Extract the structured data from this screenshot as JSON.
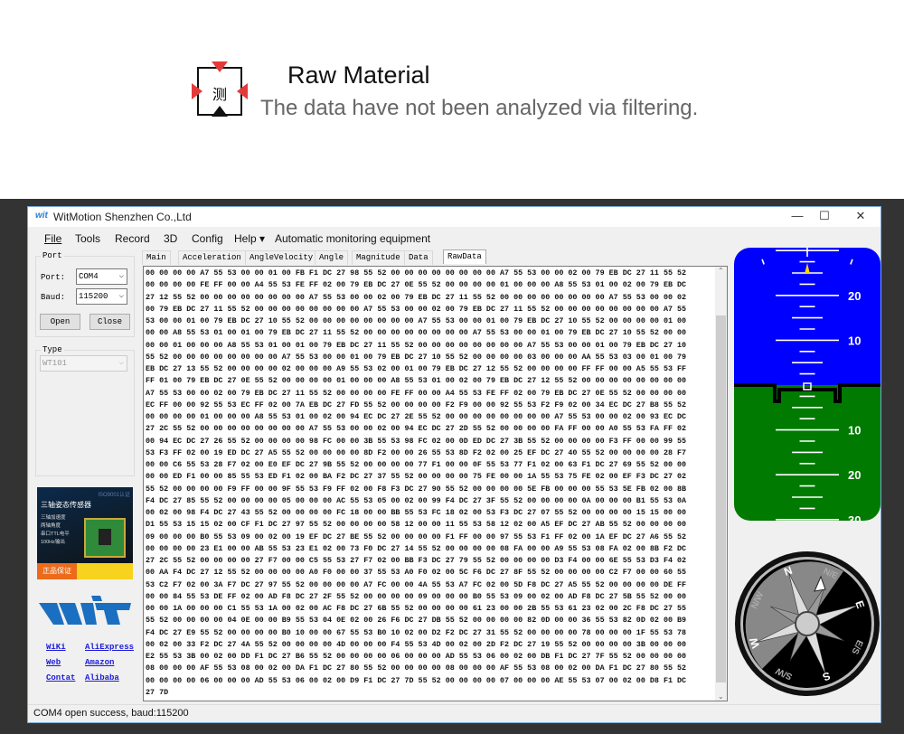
{
  "banner": {
    "icon_char": "测",
    "title": "Raw Material",
    "subtitle": "The data have not been analyzed via filtering."
  },
  "window": {
    "title": "WitMotion Shenzhen Co.,Ltd",
    "minimize": "—",
    "maximize": "☐",
    "close": "✕"
  },
  "menu": {
    "items": [
      {
        "label": "File"
      },
      {
        "label": "Tools"
      },
      {
        "label": "Record"
      },
      {
        "label": "3D"
      },
      {
        "label": "Config"
      },
      {
        "label": "Help ▾"
      }
    ],
    "caption": "Automatic monitoring equipment"
  },
  "port_group": {
    "legend": "Port",
    "port_label": "Port:",
    "port_value": "COM4",
    "baud_label": "Baud:",
    "baud_value": "115200",
    "open": "Open",
    "close": "Close"
  },
  "type_group": {
    "legend": "Type",
    "value": "WT101"
  },
  "ad": {
    "brand": "WIT",
    "cert": "ISO9001认证",
    "headline": "三轴姿态传感器",
    "features": [
      "三轴加速度",
      "两轴角度",
      "串口TTL电平",
      "100Hz输出"
    ],
    "badge": "正品保证"
  },
  "links": [
    {
      "label": "WiKi"
    },
    {
      "label": "AliExpress"
    },
    {
      "label": "Web"
    },
    {
      "label": "Amazon"
    },
    {
      "label": "Contat"
    },
    {
      "label": "Alibaba"
    }
  ],
  "tabs": [
    {
      "label": "Main"
    },
    {
      "label": "Acceleration"
    },
    {
      "label": "AngleVelocity"
    },
    {
      "label": "Angle"
    },
    {
      "label": "Magnitude"
    },
    {
      "label": "Data"
    },
    {
      "label": "RawData",
      "active": true
    }
  ],
  "raw_data": [
    "00 00 00 00 A7 55 53 00 00 01 00 FB F1 DC 27 98 55 52 00 00 00 00 00 00 00 00 A7 55 53 00 00 02 00 79 EB DC 27 11 55 52",
    "00 00 00 00 FE FF 00 00 A4 55 53 FE FF 02 00 79 EB DC 27 0E 55 52 00 00 00 00 01 00 00 00 A8 55 53 01 00 02 00 79 EB DC",
    "27 12 55 52 00 00 00 00 00 00 00 00 A7 55 53 00 00 02 00 79 EB DC 27 11 55 52 00 00 00 00 00 00 00 00 A7 55 53 00 00 02",
    "00 79 EB DC 27 11 55 52 00 00 00 00 00 00 00 00 A7 55 53 00 00 02 00 79 EB DC 27 11 55 52 00 00 00 00 00 00 00 00 A7 55",
    "53 00 00 01 00 79 EB DC 27 10 55 52 00 00 00 00 00 00 00 00 A7 55 53 00 00 01 00 79 EB DC 27 10 55 52 00 00 00 00 01 00",
    "00 00 A8 55 53 01 00 01 00 79 EB DC 27 11 55 52 00 00 00 00 00 00 00 00 A7 55 53 00 00 01 00 79 EB DC 27 10 55 52 00 00",
    "00 00 01 00 00 00 A8 55 53 01 00 01 00 79 EB DC 27 11 55 52 00 00 00 00 00 00 00 00 A7 55 53 00 00 01 00 79 EB DC 27 10",
    "55 52 00 00 00 00 00 00 00 00 A7 55 53 00 00 01 00 79 EB DC 27 10 55 52 00 00 00 00 03 00 00 00 AA 55 53 03 00 01 00 79",
    "EB DC 27 13 55 52 00 00 00 00 02 00 00 00 A9 55 53 02 00 01 00 79 EB DC 27 12 55 52 00 00 00 00 FF FF 00 00 A5 55 53 FF",
    "FF 01 00 79 EB DC 27 0E 55 52 00 00 00 00 01 00 00 00 A8 55 53 01 00 02 00 79 EB DC 27 12 55 52 00 00 00 00 00 00 00 00",
    "A7 55 53 00 00 02 00 79 EB DC 27 11 55 52 00 00 00 00 FE FF 00 00 A4 55 53 FE FF 02 00 79 EB DC 27 0E 55 52 00 00 00 00",
    "EC FF 00 00 92 55 53 EC FF 02 00 7A EB DC 27 FD 55 52 00 00 00 00 F2 F9 00 00 92 55 53 F2 F9 02 00 34 EC DC 27 B8 55 52",
    "00 00 00 00 01 00 00 00 A8 55 53 01 00 02 00 94 EC DC 27 2E 55 52 00 00 00 00 00 00 00 00 A7 55 53 00 00 02 00 93 EC DC",
    "27 2C 55 52 00 00 00 00 00 00 00 00 A7 55 53 00 00 02 00 94 EC DC 27 2D 55 52 00 00 00 00 FA FF 00 00 A0 55 53 FA FF 02",
    "00 94 EC DC 27 26 55 52 00 00 00 00 98 FC 00 00 3B 55 53 98 FC 02 00 0D ED DC 27 3B 55 52 00 00 00 00 F3 FF 00 00 99 55",
    "53 F3 FF 02 00 19 ED DC 27 A5 55 52 00 00 00 00 8D F2 00 00 26 55 53 8D F2 02 00 25 EF DC 27 40 55 52 00 00 00 00 28 F7",
    "00 00 C6 55 53 28 F7 02 00 E0 EF DC 27 9B 55 52 00 00 00 00 77 F1 00 00 0F 55 53 77 F1 02 00 63 F1 DC 27 69 55 52 00 00",
    "00 00 ED F1 00 00 85 55 53 ED F1 02 00 BA F2 DC 27 37 55 52 00 00 00 00 75 FE 00 00 1A 55 53 75 FE 02 00 EF F3 DC 27 02",
    "55 52 00 00 00 00 F9 FF 00 00 9F 55 53 F9 FF 02 00 F8 F3 DC 27 90 55 52 00 00 00 00 5E FB 00 00 00 55 53 5E FB 02 00 8B",
    "F4 DC 27 85 55 52 00 00 00 00 05 00 00 00 AC 55 53 05 00 02 00 99 F4 DC 27 3F 55 52 00 00 00 00 0A 00 00 00 B1 55 53 0A",
    "00 02 00 98 F4 DC 27 43 55 52 00 00 00 00 FC 18 00 00 BB 55 53 FC 18 02 00 53 F3 DC 27 07 55 52 00 00 00 00 15 15 00 00",
    "D1 55 53 15 15 02 00 CF F1 DC 27 97 55 52 00 00 00 00 58 12 00 00 11 55 53 58 12 02 00 A5 EF DC 27 AB 55 52 00 00 00 00",
    "09 00 00 00 B0 55 53 09 00 02 00 19 EF DC 27 BE 55 52 00 00 00 00 F1 FF 00 00 97 55 53 F1 FF 02 00 1A EF DC 27 A6 55 52",
    "00 00 00 00 23 E1 00 00 AB 55 53 23 E1 02 00 73 F0 DC 27 14 55 52 00 00 00 00 08 FA 00 00 A9 55 53 08 FA 02 00 8B F2 DC",
    "27 2C 55 52 00 00 00 00 27 F7 00 00 C5 55 53 27 F7 02 00 BB F3 DC 27 79 55 52 00 00 00 00 D3 F4 00 00 6E 55 53 D3 F4 02",
    "00 AA F4 DC 27 12 55 52 00 00 00 00 A0 F0 00 00 37 55 53 A0 F0 02 00 5C F6 DC 27 8F 55 52 00 00 00 00 C2 F7 00 00 60 55",
    "53 C2 F7 02 00 3A F7 DC 27 97 55 52 00 00 00 00 A7 FC 00 00 4A 55 53 A7 FC 02 00 5D F8 DC 27 A5 55 52 00 00 00 00 DE FF",
    "00 00 84 55 53 DE FF 02 00 AD F8 DC 27 2F 55 52 00 00 00 00 09 00 00 00 B0 55 53 09 00 02 00 AD F8 DC 27 5B 55 52 00 00",
    "00 00 1A 00 00 00 C1 55 53 1A 00 02 00 AC F8 DC 27 6B 55 52 00 00 00 00 61 23 00 00 2B 55 53 61 23 02 00 2C F8 DC 27 55",
    "55 52 00 00 00 00 04 0E 00 00 B9 55 53 04 0E 02 00 26 F6 DC 27 DB 55 52 00 00 00 00 82 0D 00 00 36 55 53 82 0D 02 00 B9",
    "F4 DC 27 E9 55 52 00 00 00 00 B0 10 00 00 67 55 53 B0 10 02 00 D2 F2 DC 27 31 55 52 00 00 00 00 78 00 00 00 1F 55 53 78",
    "00 02 00 33 F2 DC 27 4A 55 52 00 00 00 00 4D 00 00 00 F4 55 53 4D 00 02 00 2D F2 DC 27 19 55 52 00 00 00 00 3B 00 00 00",
    "E2 55 53 3B 00 02 00 DD F1 DC 27 B6 55 52 00 00 00 00 06 00 00 00 AD 55 53 06 00 02 00 DB F1 DC 27 7F 55 52 00 00 00 00",
    "08 00 00 00 AF 55 53 08 00 02 00 DA F1 DC 27 80 55 52 00 00 00 00 08 00 00 00 AF 55 53 08 00 02 00 DA F1 DC 27 80 55 52",
    "00 00 00 00 06 00 00 00 AD 55 53 06 00 02 00 D9 F1 DC 27 7D 55 52 00 00 00 00 07 00 00 00 AE 55 53 07 00 02 00 D8 F1 DC",
    "27 7D"
  ],
  "status": "COM4 open success, baud:115200",
  "attitude": {
    "sky_color": "#0000ff",
    "ground_color": "#007a00",
    "pointer_color": "#ffd700",
    "up_labels": [
      "20",
      "10"
    ],
    "down_labels": [
      "10",
      "20",
      "30"
    ]
  },
  "compass": {
    "labels": [
      "N",
      "N/E",
      "E",
      "E/S",
      "S",
      "S/W",
      "W",
      "N/W"
    ]
  }
}
